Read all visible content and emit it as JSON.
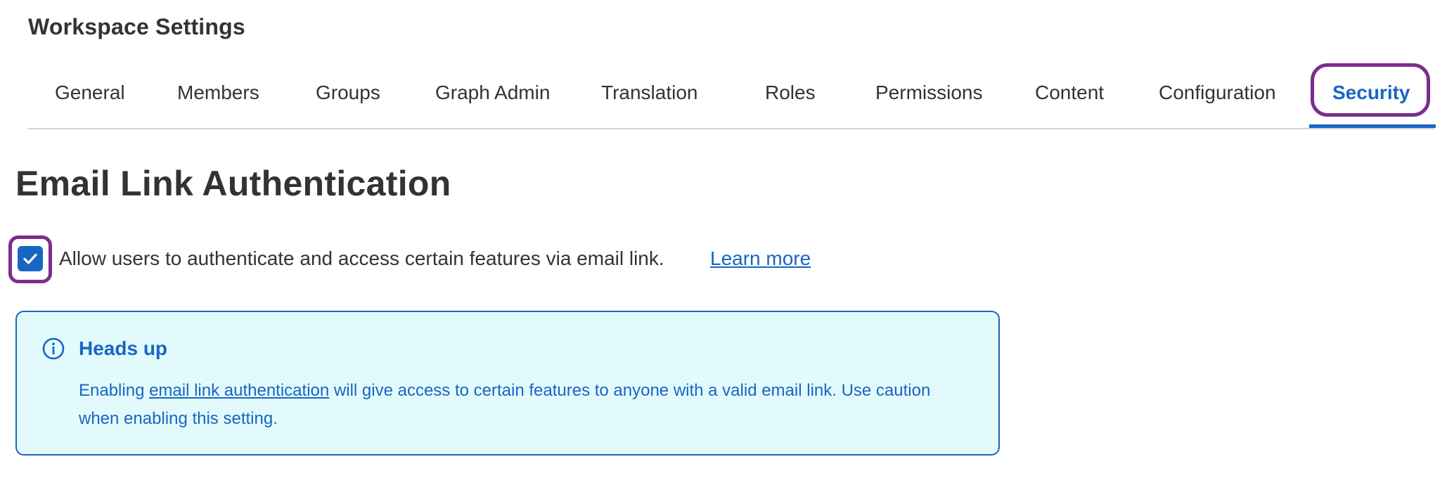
{
  "page": {
    "title": "Workspace Settings"
  },
  "tabs": [
    {
      "label": "General",
      "active": false
    },
    {
      "label": "Members",
      "active": false
    },
    {
      "label": "Groups",
      "active": false
    },
    {
      "label": "Graph Admin",
      "active": false
    },
    {
      "label": "Translation",
      "active": false
    },
    {
      "label": "Roles",
      "active": false
    },
    {
      "label": "Permissions",
      "active": false
    },
    {
      "label": "Content",
      "active": false
    },
    {
      "label": "Configuration",
      "active": false
    },
    {
      "label": "Security",
      "active": true
    }
  ],
  "section": {
    "title": "Email Link Authentication"
  },
  "email_link_setting": {
    "checked": true,
    "label": "Allow users to authenticate and access certain features via email link.",
    "learn_more": "Learn more",
    "checkbox_icon": "checkmark-icon"
  },
  "callout": {
    "icon": "info-icon",
    "title": "Heads up",
    "body_before": "Enabling ",
    "body_link": "email link authentication",
    "body_after": " will give access to certain features to anyone with a valid email link. Use caution when enabling this setting."
  },
  "colors": {
    "accent": "#1766c2",
    "highlight": "#7b2d8e",
    "callout_bg": "#e3fafc",
    "text": "#333333",
    "divider": "#d4d4d4"
  }
}
